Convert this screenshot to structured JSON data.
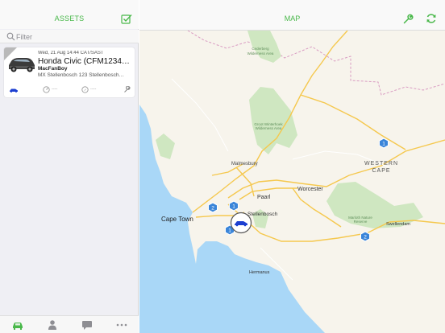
{
  "sidebar": {
    "title": "ASSETS",
    "filter_placeholder": "Filter",
    "asset": {
      "timestamp": "Wed, 21 Aug 14:44 CAT/SAST",
      "name": "Honda Civic (CFM1234…",
      "user": "MacFanBoy",
      "address": "MX Stellenbosch 123 Stellenbosch…",
      "speed_value": "----",
      "heading_value": "----"
    },
    "tabs": [
      {
        "icon": "car-icon"
      },
      {
        "icon": "driver-icon"
      },
      {
        "icon": "message-icon"
      },
      {
        "icon": "more-icon"
      }
    ]
  },
  "map_panel": {
    "title": "MAP",
    "labels": {
      "cederberg": "Cederberg\nWilderness Area",
      "groot": "Groot Winterhoek\nWilderness Area",
      "malmesbury": "Malmesbury",
      "western_cape": "WESTERN\nCAPE",
      "paarl": "Paarl",
      "worcester": "Worcester",
      "cape_town": "Cape Town",
      "stellenbosch": "Stellenbosch",
      "marloth": "Marloth Nature\nReserve",
      "swellendam": "Swellendam",
      "hermanus": "Hermanus"
    },
    "markers": [
      {
        "label": "1"
      },
      {
        "label": "1"
      },
      {
        "label": "2"
      },
      {
        "label": "2"
      },
      {
        "label": "1"
      }
    ]
  },
  "colors": {
    "accent": "#49b84a",
    "vehicle": "#1c3fd1",
    "marker": "#3a85d9",
    "park": "#cfe7c1",
    "water": "#a9d7f7",
    "land": "#f7f4ec"
  }
}
